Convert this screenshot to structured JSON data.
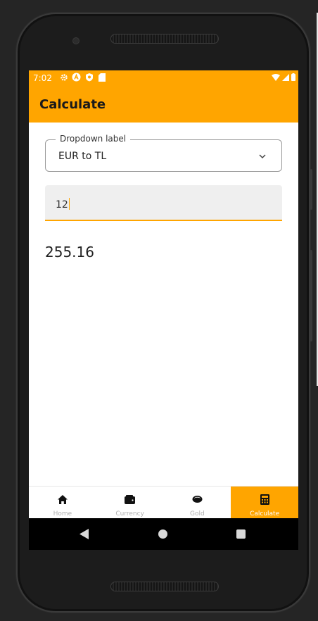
{
  "status_bar": {
    "time": "7:02",
    "left_icons": [
      "settings-icon",
      "a-badge-icon",
      "shield-icon",
      "sd-card-icon"
    ],
    "right_icons": [
      "wifi-icon",
      "signal-icon",
      "battery-icon"
    ]
  },
  "app_bar": {
    "title": "Calculate"
  },
  "dropdown": {
    "label": "Dropdown label",
    "selected": "EUR to TL"
  },
  "amount_input": {
    "value": "12"
  },
  "result": "255.16",
  "bottom_nav": {
    "items": [
      {
        "label": "Home",
        "icon": "home-icon",
        "active": false
      },
      {
        "label": "Currency",
        "icon": "wallet-icon",
        "active": false
      },
      {
        "label": "Gold",
        "icon": "coin-icon",
        "active": false
      },
      {
        "label": "Calculate",
        "icon": "calculator-icon",
        "active": true
      }
    ]
  },
  "colors": {
    "accent": "#ffa500",
    "background": "#252525",
    "screen": "#ffffff"
  }
}
